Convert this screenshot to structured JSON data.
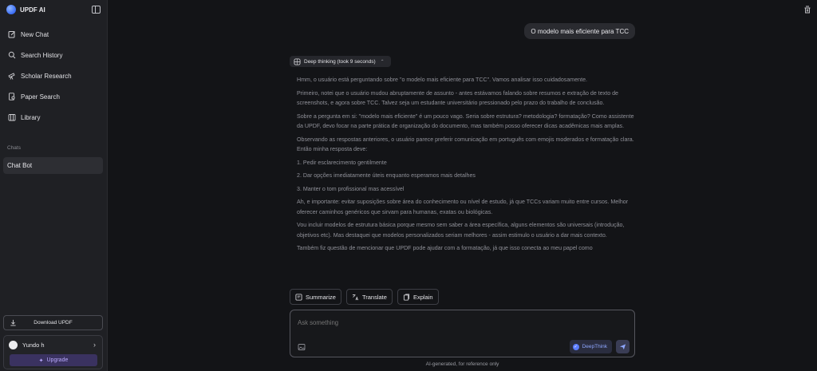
{
  "sidebar": {
    "brand": "UPDF AI",
    "nav": [
      {
        "label": "New Chat",
        "icon": "edit-icon"
      },
      {
        "label": "Search History",
        "icon": "search-icon"
      },
      {
        "label": "Scholar Research",
        "icon": "telescope-icon"
      },
      {
        "label": "Paper Search",
        "icon": "paper-search-icon"
      },
      {
        "label": "Library",
        "icon": "library-icon"
      }
    ],
    "chats_label": "Chats",
    "chat_items": [
      "Chat Bot"
    ],
    "download_label": "Download UPDF",
    "user_name": "Yundo h",
    "upgrade_label": "Upgrade"
  },
  "conversation": {
    "user_message": "O modelo mais eficiente para TCC",
    "thinking_label": "Deep thinking (took 9 seconds)",
    "reasoning": [
      "Hmm, o usuário está perguntando sobre \"o modelo mais eficiente para TCC\". Vamos analisar isso cuidadosamente.",
      "Primeiro, notei que o usuário mudou abruptamente de assunto - antes estávamos falando sobre resumos e extração de texto de screenshots, e agora sobre TCC. Talvez seja um estudante universitário pressionado pelo prazo do trabalho de conclusão.",
      "Sobre a pergunta em si: \"modelo mais eficiente\" é um pouco vago. Seria sobre estrutura? metodologia? formatação? Como assistente da UPDF, devo focar na parte prática de organização do documento, mas também posso oferecer dicas acadêmicas mais amplas.",
      "Observando as respostas anteriores, o usuário parece preferir comunicação em português com emojis moderados e formatação clara. Então minha resposta deve:",
      "1. Pedir esclarecimento gentilmente",
      "2. Dar opções imediatamente úteis enquanto esperamos mais detalhes",
      "3. Manter o tom profissional mas acessível",
      "Ah, e importante: evitar suposições sobre área do conhecimento ou nível de estudo, já que TCCs variam muito entre cursos. Melhor oferecer caminhos genéricos que sirvam para humanas, exatas ou biológicas.",
      "Vou incluir modelos de estrutura básica porque mesmo sem saber a área específica, alguns elementos são universais (introdução, objetivos etc). Mas destaquei que modelos personalizados seriam melhores - assim estimulo o usuário a dar mais contexto.",
      "Também fiz questão de mencionar que UPDF pode ajudar com a formatação, já que isso conecta ao meu papel como"
    ]
  },
  "actions": [
    {
      "label": "Summarize",
      "icon": "summarize-icon"
    },
    {
      "label": "Translate",
      "icon": "translate-icon"
    },
    {
      "label": "Explain",
      "icon": "explain-icon"
    }
  ],
  "input": {
    "placeholder": "Ask something",
    "deepthink_label": "DeepThink"
  },
  "footer_note": "AI-generated, for reference only",
  "colors": {
    "background": "#131417",
    "sidebar": "#1f2024",
    "accent": "#5b7cff",
    "upgrade_bg": "#3a3260"
  }
}
